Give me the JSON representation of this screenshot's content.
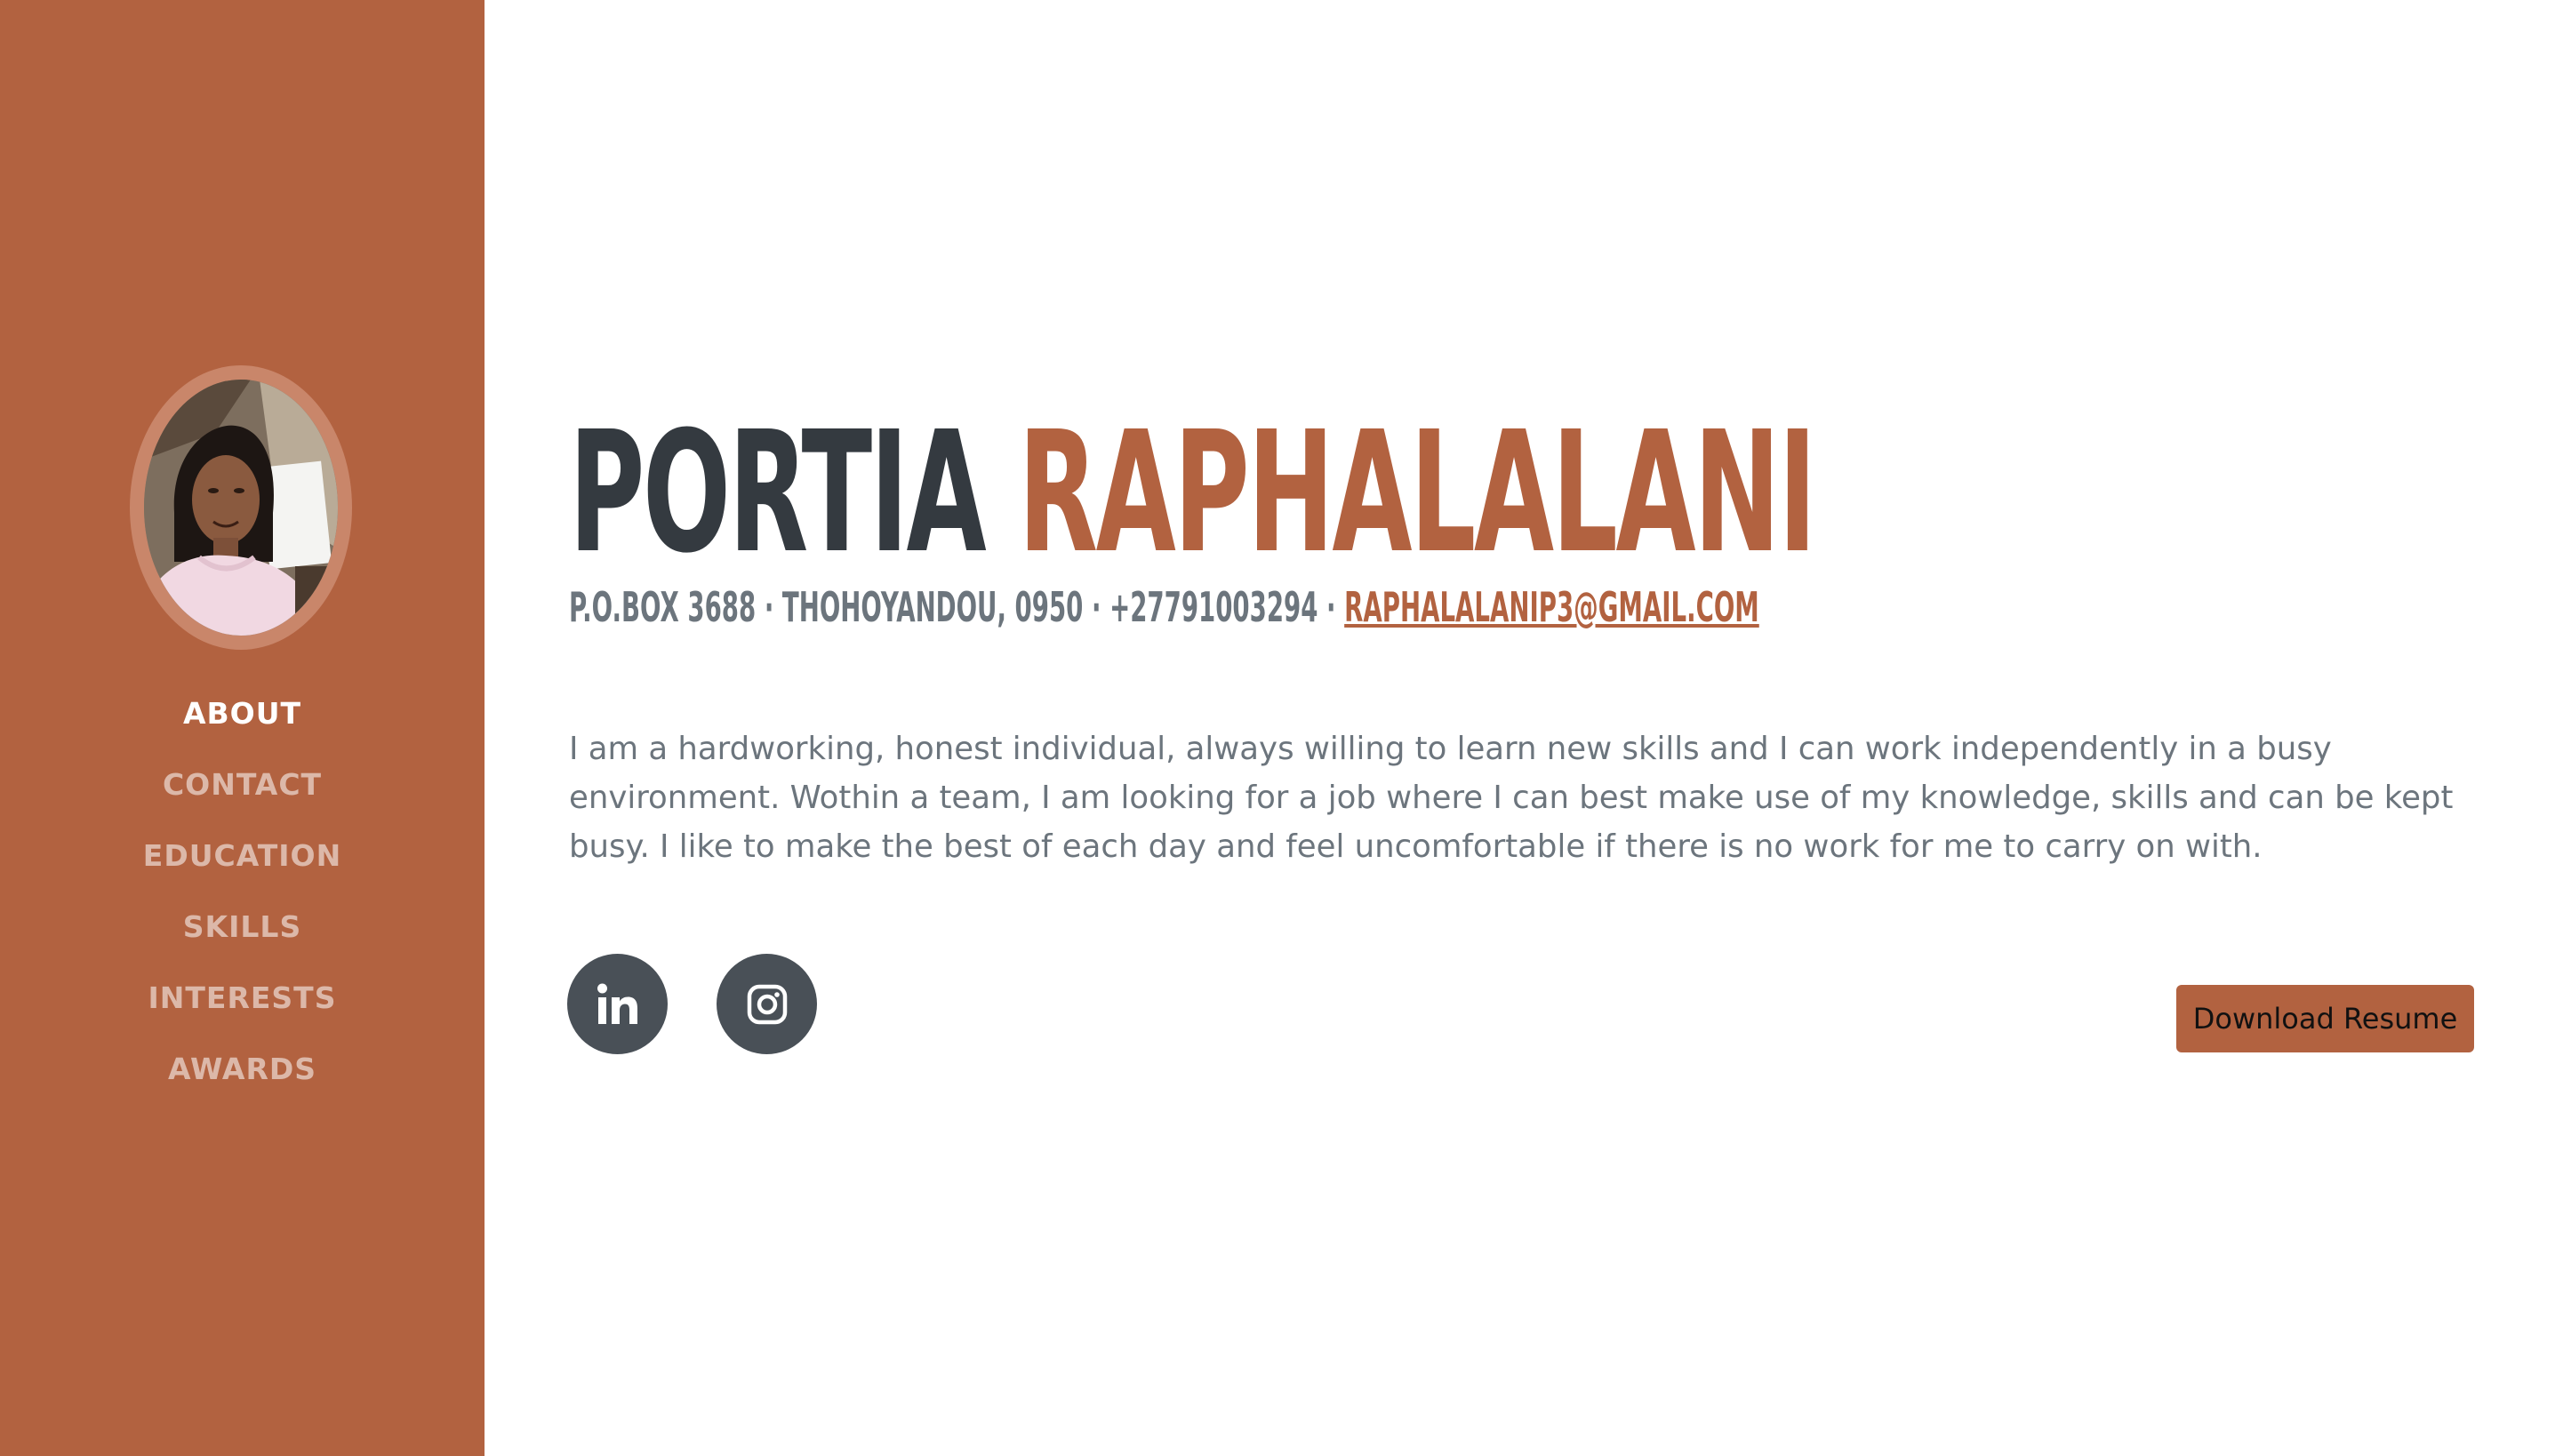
{
  "sidebar": {
    "avatar_alt": "Profile photo",
    "nav": [
      {
        "label": "ABOUT",
        "active": true
      },
      {
        "label": "CONTACT",
        "active": false
      },
      {
        "label": "EDUCATION",
        "active": false
      },
      {
        "label": "SKILLS",
        "active": false
      },
      {
        "label": "INTERESTS",
        "active": false
      },
      {
        "label": "AWARDS",
        "active": false
      }
    ]
  },
  "header": {
    "first_name": "PORTIA",
    "last_name": "RAPHALALANI",
    "contact_text": "P.O.BOX 3688 · THOHOYANDOU, 0950 · +27791003294 · ",
    "email": "RAPHALALANIP3@GMAIL.COM"
  },
  "about": {
    "text": "I am a hardworking, honest individual, always willing to learn new skills and I can work independently in a busy environment. Wothin a team, I am looking for a job where I can best make use of my knowledge, skills and can be kept busy. I like to make the best of each day and feel uncomfortable if there is no work for me to carry on with."
  },
  "social": [
    {
      "icon": "linkedin-icon"
    },
    {
      "icon": "instagram-icon"
    }
  ],
  "actions": {
    "download_label": "Download Resume"
  },
  "colors": {
    "primary": "#b26240",
    "dark": "#343a40",
    "muted": "#6c757d",
    "social_bg": "#495057"
  }
}
